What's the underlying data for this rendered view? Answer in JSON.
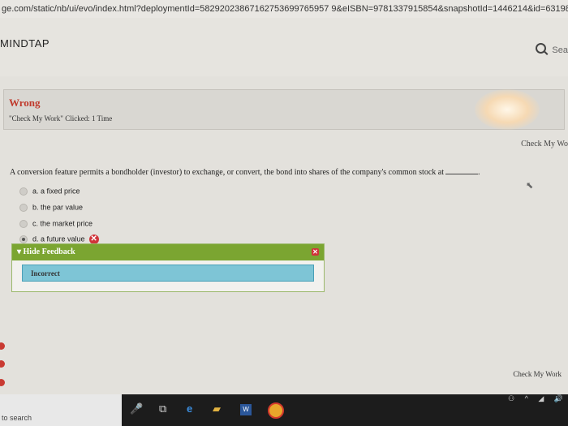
{
  "browser": {
    "url": "ge.com/static/nb/ui/evo/index.html?deploymentId=58292023867162753699765957 9&eISBN=9781337915854&snapshotId=1446214&id=6319854"
  },
  "header": {
    "brand": "MINDTAP",
    "search_label": "Sea"
  },
  "status": {
    "title": "Wrong",
    "note": "\"Check My Work\" Clicked: 1 Time"
  },
  "check_top_label": "Check My Wo",
  "question": {
    "text": "A conversion feature permits a bondholder (investor) to exchange, or convert, the bond into shares of the company's common stock at",
    "options": [
      {
        "label": "a. a fixed price",
        "selected": false
      },
      {
        "label": "b. the par value",
        "selected": false
      },
      {
        "label": "c. the market price",
        "selected": false
      },
      {
        "label": "d. a future value",
        "selected": true
      }
    ]
  },
  "feedback": {
    "header": "Hide Feedback",
    "result": "Incorrect"
  },
  "check_bottom_label": "Check My Work",
  "taskbar": {
    "search_text": "to search",
    "app_badge": "W"
  },
  "colors": {
    "wrong_red": "#c0392b",
    "feedback_green": "#7ba531",
    "incorrect_blue": "#7ec5d6"
  },
  "icons": [
    "search-icon",
    "incorrect-x-icon",
    "close-icon",
    "browser-edge-icon",
    "file-explorer-icon",
    "word-icon",
    "chrome-icon",
    "task-view-icon",
    "microphone-icon"
  ]
}
